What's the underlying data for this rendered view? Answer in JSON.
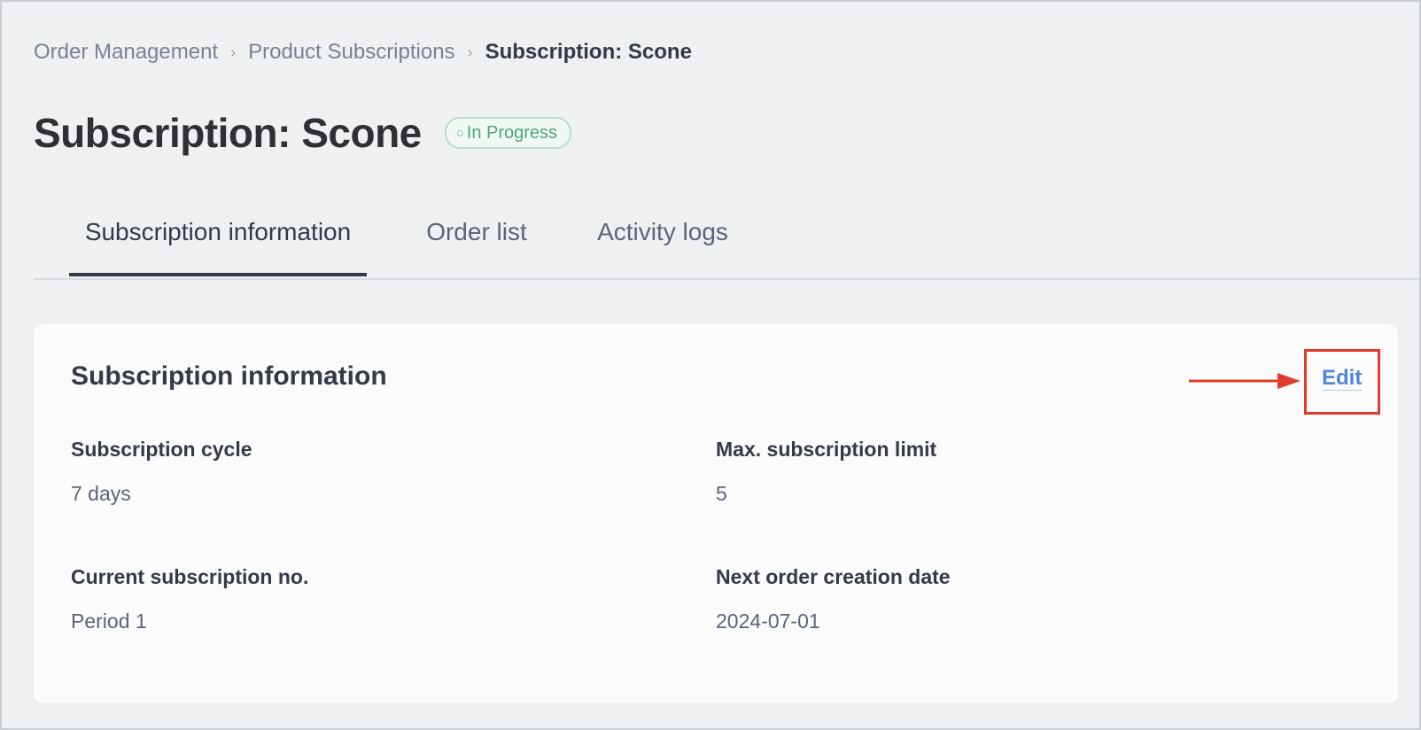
{
  "breadcrumb": {
    "items": [
      "Order Management",
      "Product Subscriptions"
    ],
    "current": "Subscription: Scone",
    "separator": "›"
  },
  "page": {
    "title": "Subscription: Scone",
    "status": "In Progress"
  },
  "tabs": [
    {
      "label": "Subscription information",
      "active": true
    },
    {
      "label": "Order list",
      "active": false
    },
    {
      "label": "Activity logs",
      "active": false
    }
  ],
  "card": {
    "title": "Subscription information",
    "edit_label": "Edit",
    "fields": [
      {
        "label": "Subscription cycle",
        "value": "7 days"
      },
      {
        "label": "Max. subscription limit",
        "value": "5"
      },
      {
        "label": "Current subscription no.",
        "value": "Period 1"
      },
      {
        "label": "Next order creation date",
        "value": "2024-07-01"
      }
    ]
  },
  "colors": {
    "accent": "#4f86d9",
    "status_green": "#4fa57c",
    "annotation_red": "#e03c2b"
  }
}
